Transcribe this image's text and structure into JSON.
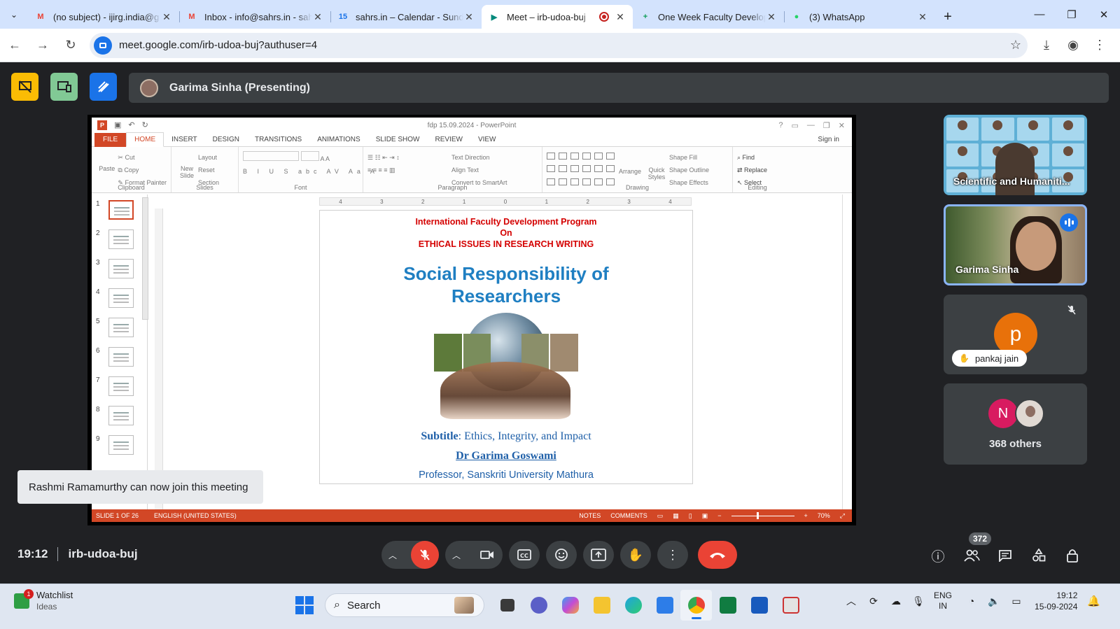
{
  "browser": {
    "tabs": [
      {
        "title": "(no subject) - ijirg.india@g",
        "icon": "gmail-icon",
        "color": "#ea4335",
        "glyph": "M"
      },
      {
        "title": "Inbox - info@sahrs.in - sah",
        "icon": "gmail-icon",
        "color": "#ea4335",
        "glyph": "M"
      },
      {
        "title": "sahrs.in – Calendar - Sunda",
        "icon": "calendar-icon",
        "color": "#1a73e8",
        "glyph": "15"
      },
      {
        "title": "Meet – irb-udoa-buj",
        "icon": "meet-icon",
        "color": "#00897b",
        "glyph": "▶"
      },
      {
        "title": "One Week Faculty Develop",
        "icon": "sheets-icon",
        "color": "#0f9d58",
        "glyph": "+"
      },
      {
        "title": "(3) WhatsApp",
        "icon": "whatsapp-icon",
        "color": "#25d366",
        "glyph": "●"
      }
    ],
    "url": "meet.google.com/irb-udoa-buj?authuser=4"
  },
  "meet": {
    "presenter": "Garima Sinha (Presenting)",
    "slide_app": {
      "doc_title": "fdp 15.09.2024 - PowerPoint",
      "tabs": [
        "FILE",
        "HOME",
        "INSERT",
        "DESIGN",
        "TRANSITIONS",
        "ANIMATIONS",
        "SLIDE SHOW",
        "REVIEW",
        "VIEW"
      ],
      "signin": "Sign in",
      "groups": {
        "clipboard": {
          "name": "Clipboard",
          "paste": "Paste",
          "cut": "Cut",
          "copy": "Copy",
          "format_painter": "Format Painter"
        },
        "slides": {
          "name": "Slides",
          "new_slide": "New Slide",
          "layout": "Layout",
          "reset": "Reset",
          "section": "Section"
        },
        "font": {
          "name": "Font"
        },
        "paragraph": {
          "name": "Paragraph",
          "text_direction": "Text Direction",
          "align_text": "Align Text",
          "convert": "Convert to SmartArt"
        },
        "drawing": {
          "name": "Drawing",
          "arrange": "Arrange",
          "quick_styles": "Quick Styles",
          "fill": "Shape Fill",
          "outline": "Shape Outline",
          "effects": "Shape Effects"
        },
        "editing": {
          "name": "Editing",
          "find": "Find",
          "replace": "Replace",
          "select": "Select"
        }
      },
      "thumbnails": [
        "1",
        "2",
        "3",
        "4",
        "5",
        "6",
        "7",
        "8",
        "9"
      ],
      "ruler": [
        "4",
        "3",
        "2",
        "1",
        "0",
        "1",
        "2",
        "3",
        "4"
      ],
      "slide": {
        "program_line1": "International Faculty Development Program",
        "program_line2": "On",
        "program_line3": "ETHICAL ISSUES IN RESEARCH WRITING",
        "title_line1": "Social Responsibility of",
        "title_line2": "Researchers",
        "subtitle_label": "Subtitle",
        "subtitle_text": ": Ethics, Integrity, and Impact",
        "author": "Dr Garima Goswami",
        "affiliation": "Professor, Sanskriti University Mathura"
      },
      "status": {
        "slide_of": "SLIDE 1 OF 26",
        "language": "ENGLISH (UNITED STATES)",
        "notes": "NOTES",
        "comments": "COMMENTS",
        "zoom": "70%"
      }
    },
    "participants": [
      {
        "name": "Scientific and Humaniti..."
      },
      {
        "name": "Garima Sinha"
      },
      {
        "name": "pankaj jain",
        "initial": "p",
        "color": "#e8710a"
      },
      {
        "initial": "N",
        "color": "#d81b60",
        "others": "368 others"
      }
    ],
    "toast": "Rashmi Ramamurthy can now join this meeting",
    "time": "19:12",
    "meeting_code": "irb-udoa-buj",
    "people_count": "372"
  },
  "taskbar": {
    "weather_title": "Watchlist",
    "weather_sub": "Ideas",
    "weather_badge": "1",
    "search_placeholder": "Search",
    "lang_line1": "ENG",
    "lang_line2": "IN",
    "time": "19:12",
    "date": "15-09-2024"
  }
}
